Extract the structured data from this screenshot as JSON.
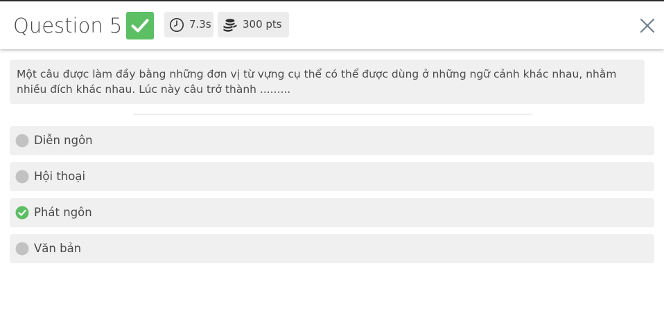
{
  "header": {
    "title": "Question 5",
    "status_icon": "check-icon",
    "time": "7.3s",
    "points": "300 pts"
  },
  "question": {
    "text": "Một câu được làm đầy bằng những đơn vị từ vựng cụ thể có thể được dùng ở những ngữ cảnh khác nhau, nhằm nhiều đích khác nhau. Lúc này câu trở thành ........."
  },
  "answers": [
    {
      "label": "Diễn ngôn",
      "state": "unselected"
    },
    {
      "label": "Hội thoại",
      "state": "unselected"
    },
    {
      "label": "Phát ngôn",
      "state": "correct"
    },
    {
      "label": "Văn bản",
      "state": "unselected"
    }
  ],
  "colors": {
    "correct": "#5cbf64",
    "chip_background": "#ececec",
    "card_background": "#f0f0f0",
    "unselected_marker": "#c2c2c2",
    "close_icon": "#6e7f8c"
  }
}
